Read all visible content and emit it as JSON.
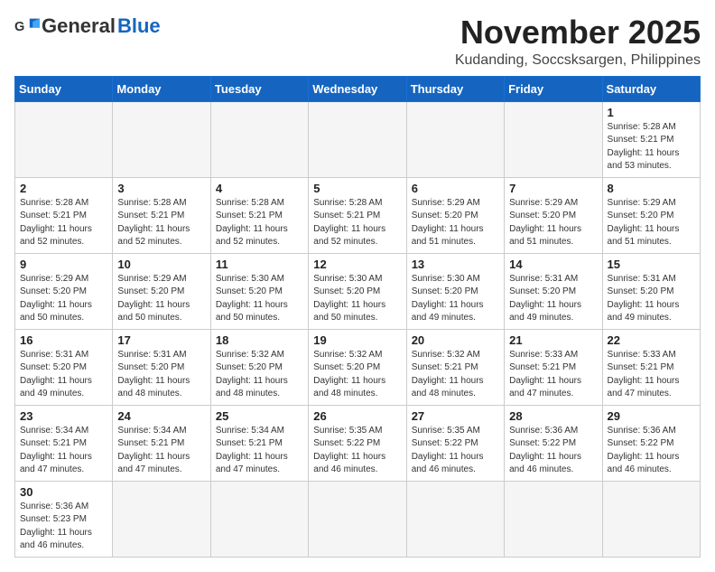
{
  "header": {
    "logo_general": "General",
    "logo_blue": "Blue",
    "month_year": "November 2025",
    "location": "Kudanding, Soccsksargen, Philippines"
  },
  "weekdays": [
    "Sunday",
    "Monday",
    "Tuesday",
    "Wednesday",
    "Thursday",
    "Friday",
    "Saturday"
  ],
  "days": [
    {
      "date": "",
      "info": ""
    },
    {
      "date": "",
      "info": ""
    },
    {
      "date": "",
      "info": ""
    },
    {
      "date": "",
      "info": ""
    },
    {
      "date": "",
      "info": ""
    },
    {
      "date": "",
      "info": ""
    },
    {
      "date": "1",
      "info": "Sunrise: 5:28 AM\nSunset: 5:21 PM\nDaylight: 11 hours\nand 53 minutes."
    },
    {
      "date": "2",
      "info": "Sunrise: 5:28 AM\nSunset: 5:21 PM\nDaylight: 11 hours\nand 52 minutes."
    },
    {
      "date": "3",
      "info": "Sunrise: 5:28 AM\nSunset: 5:21 PM\nDaylight: 11 hours\nand 52 minutes."
    },
    {
      "date": "4",
      "info": "Sunrise: 5:28 AM\nSunset: 5:21 PM\nDaylight: 11 hours\nand 52 minutes."
    },
    {
      "date": "5",
      "info": "Sunrise: 5:28 AM\nSunset: 5:21 PM\nDaylight: 11 hours\nand 52 minutes."
    },
    {
      "date": "6",
      "info": "Sunrise: 5:29 AM\nSunset: 5:20 PM\nDaylight: 11 hours\nand 51 minutes."
    },
    {
      "date": "7",
      "info": "Sunrise: 5:29 AM\nSunset: 5:20 PM\nDaylight: 11 hours\nand 51 minutes."
    },
    {
      "date": "8",
      "info": "Sunrise: 5:29 AM\nSunset: 5:20 PM\nDaylight: 11 hours\nand 51 minutes."
    },
    {
      "date": "9",
      "info": "Sunrise: 5:29 AM\nSunset: 5:20 PM\nDaylight: 11 hours\nand 50 minutes."
    },
    {
      "date": "10",
      "info": "Sunrise: 5:29 AM\nSunset: 5:20 PM\nDaylight: 11 hours\nand 50 minutes."
    },
    {
      "date": "11",
      "info": "Sunrise: 5:30 AM\nSunset: 5:20 PM\nDaylight: 11 hours\nand 50 minutes."
    },
    {
      "date": "12",
      "info": "Sunrise: 5:30 AM\nSunset: 5:20 PM\nDaylight: 11 hours\nand 50 minutes."
    },
    {
      "date": "13",
      "info": "Sunrise: 5:30 AM\nSunset: 5:20 PM\nDaylight: 11 hours\nand 49 minutes."
    },
    {
      "date": "14",
      "info": "Sunrise: 5:31 AM\nSunset: 5:20 PM\nDaylight: 11 hours\nand 49 minutes."
    },
    {
      "date": "15",
      "info": "Sunrise: 5:31 AM\nSunset: 5:20 PM\nDaylight: 11 hours\nand 49 minutes."
    },
    {
      "date": "16",
      "info": "Sunrise: 5:31 AM\nSunset: 5:20 PM\nDaylight: 11 hours\nand 49 minutes."
    },
    {
      "date": "17",
      "info": "Sunrise: 5:31 AM\nSunset: 5:20 PM\nDaylight: 11 hours\nand 48 minutes."
    },
    {
      "date": "18",
      "info": "Sunrise: 5:32 AM\nSunset: 5:20 PM\nDaylight: 11 hours\nand 48 minutes."
    },
    {
      "date": "19",
      "info": "Sunrise: 5:32 AM\nSunset: 5:20 PM\nDaylight: 11 hours\nand 48 minutes."
    },
    {
      "date": "20",
      "info": "Sunrise: 5:32 AM\nSunset: 5:21 PM\nDaylight: 11 hours\nand 48 minutes."
    },
    {
      "date": "21",
      "info": "Sunrise: 5:33 AM\nSunset: 5:21 PM\nDaylight: 11 hours\nand 47 minutes."
    },
    {
      "date": "22",
      "info": "Sunrise: 5:33 AM\nSunset: 5:21 PM\nDaylight: 11 hours\nand 47 minutes."
    },
    {
      "date": "23",
      "info": "Sunrise: 5:34 AM\nSunset: 5:21 PM\nDaylight: 11 hours\nand 47 minutes."
    },
    {
      "date": "24",
      "info": "Sunrise: 5:34 AM\nSunset: 5:21 PM\nDaylight: 11 hours\nand 47 minutes."
    },
    {
      "date": "25",
      "info": "Sunrise: 5:34 AM\nSunset: 5:21 PM\nDaylight: 11 hours\nand 47 minutes."
    },
    {
      "date": "26",
      "info": "Sunrise: 5:35 AM\nSunset: 5:22 PM\nDaylight: 11 hours\nand 46 minutes."
    },
    {
      "date": "27",
      "info": "Sunrise: 5:35 AM\nSunset: 5:22 PM\nDaylight: 11 hours\nand 46 minutes."
    },
    {
      "date": "28",
      "info": "Sunrise: 5:36 AM\nSunset: 5:22 PM\nDaylight: 11 hours\nand 46 minutes."
    },
    {
      "date": "29",
      "info": "Sunrise: 5:36 AM\nSunset: 5:22 PM\nDaylight: 11 hours\nand 46 minutes."
    },
    {
      "date": "30",
      "info": "Sunrise: 5:36 AM\nSunset: 5:23 PM\nDaylight: 11 hours\nand 46 minutes."
    },
    {
      "date": "",
      "info": ""
    },
    {
      "date": "",
      "info": ""
    },
    {
      "date": "",
      "info": ""
    },
    {
      "date": "",
      "info": ""
    },
    {
      "date": "",
      "info": ""
    },
    {
      "date": "",
      "info": ""
    }
  ]
}
